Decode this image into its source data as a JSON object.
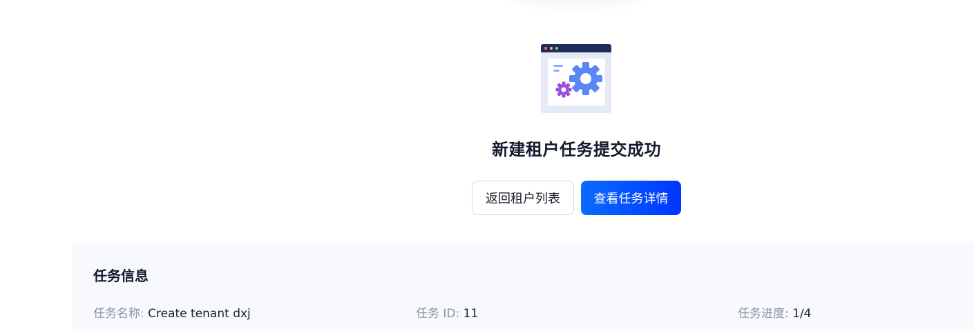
{
  "result": {
    "title": "新建租户任务提交成功",
    "illustration_icon": "settings-window-icon",
    "colors": {
      "window_bar": "#1f2d5c",
      "window_body": "#e4eaf6",
      "gear_large": "#5b86f5",
      "gear_small": "#9b4fe0"
    }
  },
  "actions": {
    "back_label": "返回租户列表",
    "view_details_label": "查看任务详情",
    "primary_color": "#0050ff"
  },
  "task_info": {
    "title": "任务信息",
    "name_label": "任务名称:",
    "name_value": "Create tenant dxj",
    "id_label": "任务 ID:",
    "id_value": "11",
    "progress_label": "任务进度:",
    "progress_value": "1/4"
  }
}
